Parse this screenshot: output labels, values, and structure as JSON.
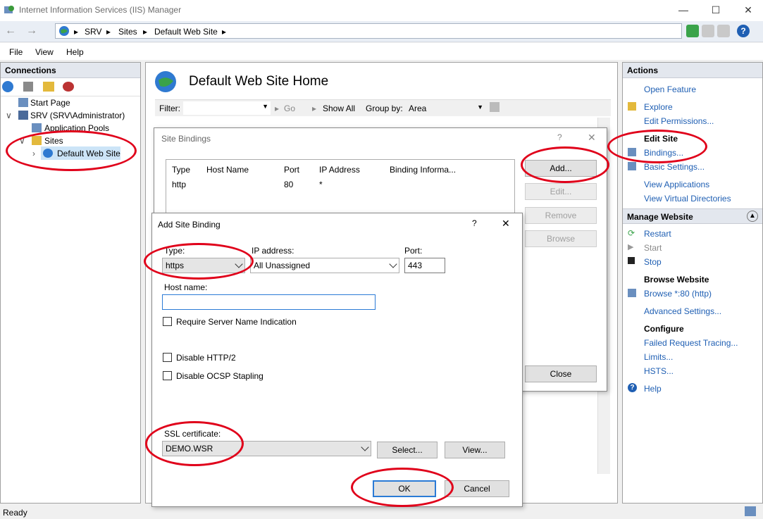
{
  "window": {
    "title": "Internet Information Services (IIS) Manager"
  },
  "breadcrumb": [
    "SRV",
    "Sites",
    "Default Web Site"
  ],
  "menu": [
    "File",
    "View",
    "Help"
  ],
  "connections": {
    "header": "Connections",
    "tree": [
      "Start Page",
      "SRV (SRV\\Administrator)",
      "Application Pools",
      "Sites",
      "Default Web Site"
    ]
  },
  "center": {
    "title": "Default Web Site Home",
    "filter_label": "Filter:",
    "go": "Go",
    "show_all": "Show All",
    "group_by_label": "Group by:",
    "group_by_value": "Area"
  },
  "site_bindings": {
    "title": "Site Bindings",
    "columns": [
      "Type",
      "Host Name",
      "Port",
      "IP Address",
      "Binding Informa..."
    ],
    "rows": [
      {
        "type": "http",
        "host": "",
        "port": "80",
        "ip": "*",
        "info": ""
      }
    ],
    "buttons": {
      "add": "Add...",
      "edit": "Edit...",
      "remove": "Remove",
      "browse": "Browse",
      "close": "Close"
    }
  },
  "add_binding": {
    "title": "Add Site Binding",
    "type_label": "Type:",
    "type_value": "https",
    "ip_label": "IP address:",
    "ip_value": "All Unassigned",
    "port_label": "Port:",
    "port_value": "443",
    "host_label": "Host name:",
    "host_value": "",
    "sni_label": "Require Server Name Indication",
    "http2_label": "Disable HTTP/2",
    "ocsp_label": "Disable OCSP Stapling",
    "ssl_label": "SSL certificate:",
    "ssl_value": "DEMO.WSR",
    "select_btn": "Select...",
    "view_btn": "View...",
    "ok": "OK",
    "cancel": "Cancel"
  },
  "actions": {
    "header": "Actions",
    "open_feature": "Open Feature",
    "explore": "Explore",
    "edit_permissions": "Edit Permissions...",
    "edit_site_head": "Edit Site",
    "bindings": "Bindings...",
    "basic_settings": "Basic Settings...",
    "view_applications": "View Applications",
    "view_virtual_dirs": "View Virtual Directories",
    "manage_website": "Manage Website",
    "restart": "Restart",
    "start": "Start",
    "stop": "Stop",
    "browse_website": "Browse Website",
    "browse_80": "Browse *:80 (http)",
    "advanced_settings": "Advanced Settings...",
    "configure": "Configure",
    "failed_request": "Failed Request Tracing...",
    "limits": "Limits...",
    "hsts": "HSTS...",
    "help": "Help"
  },
  "status": "Ready"
}
